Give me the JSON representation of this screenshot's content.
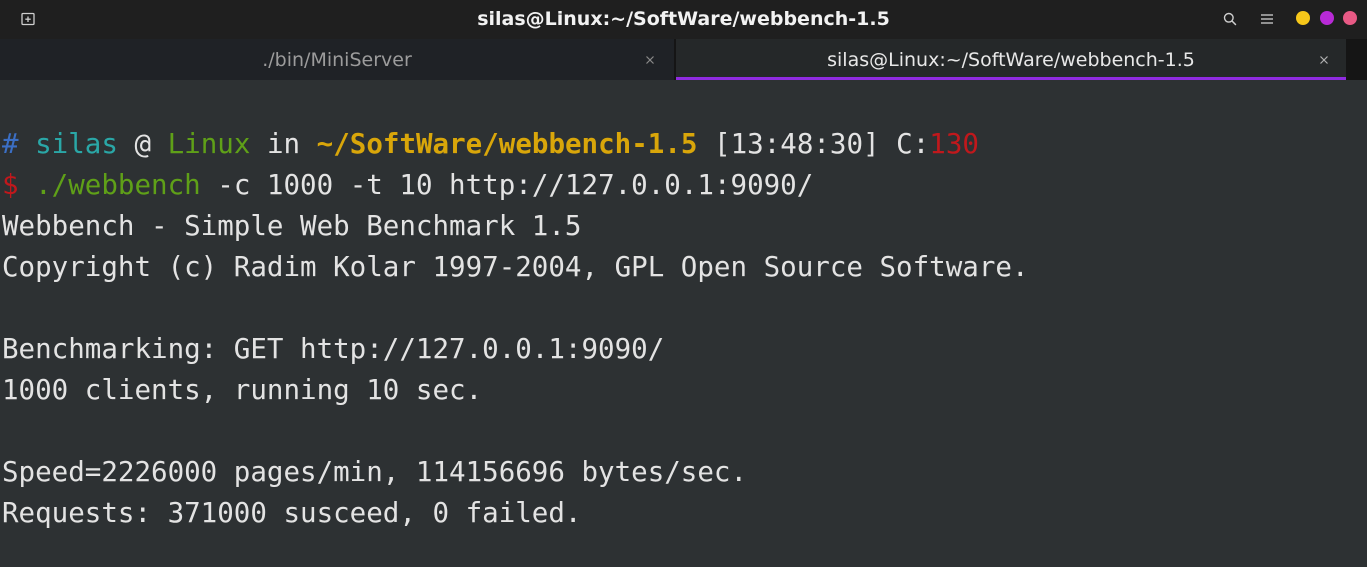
{
  "window": {
    "title": "silas@Linux:~/SoftWare/webbench-1.5"
  },
  "icons": {
    "new_tab": "new-tab-icon",
    "search": "search-icon",
    "menu": "hamburger-menu-icon",
    "dropdown": "chevron-down-icon",
    "tab_close": "close-icon"
  },
  "colors": {
    "minimize": "#f6c71a",
    "maximize": "#b82ad6",
    "close": "#e85a85",
    "active_tab_accent": "#8f2be0",
    "prompt_hash": "#3b6fc5",
    "prompt_user": "#2aa7a7",
    "prompt_host": "#5fa018",
    "prompt_path": "#d9a60a",
    "prompt_exit_code": "#c0181c",
    "prompt_dollar": "#c0181c",
    "command": "#5fa018"
  },
  "tabs": [
    {
      "label": "./bin/MiniServer",
      "active": false
    },
    {
      "label": "silas@Linux:~/SoftWare/webbench-1.5",
      "active": true
    }
  ],
  "terminal": {
    "prompt": {
      "hash": "#",
      "user": "silas",
      "at": "@",
      "host": "Linux",
      "in": "in",
      "path": "~/SoftWare/webbench-1.5",
      "time": "[13:48:30]",
      "exit_label": "C:",
      "exit_code": "130"
    },
    "command": {
      "dollar": "$",
      "program": "./webbench",
      "args": "-c 1000 -t 10 http://127.0.0.1:9090/"
    },
    "output": [
      "Webbench - Simple Web Benchmark 1.5",
      "Copyright (c) Radim Kolar 1997-2004, GPL Open Source Software.",
      "",
      "Benchmarking: GET http://127.0.0.1:9090/",
      "1000 clients, running 10 sec.",
      "",
      "Speed=2226000 pages/min, 114156696 bytes/sec.",
      "Requests: 371000 susceed, 0 failed."
    ]
  }
}
